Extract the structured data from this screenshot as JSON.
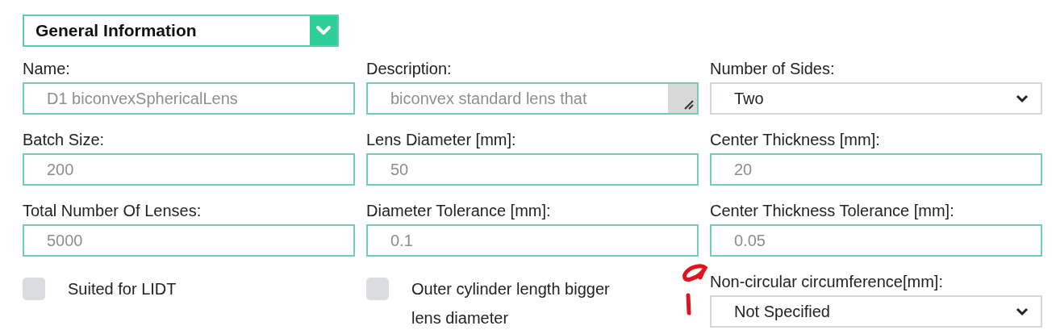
{
  "section": {
    "title": "General Information",
    "expanded": true
  },
  "fields": [
    {
      "kind": "text",
      "label": "Name:",
      "placeholder": "D1 biconvexSphericalLens"
    },
    {
      "kind": "textarea",
      "label": "Description:",
      "placeholder": "biconvex standard lens that"
    },
    {
      "kind": "select",
      "label": "Number of Sides:",
      "value": "Two"
    },
    {
      "kind": "text",
      "label": "Batch Size:",
      "placeholder": "200"
    },
    {
      "kind": "text",
      "label": "Lens Diameter [mm]:",
      "placeholder": "50"
    },
    {
      "kind": "text",
      "label": "Center Thickness [mm]:",
      "placeholder": "20"
    },
    {
      "kind": "text",
      "label": "Total Number Of Lenses:",
      "placeholder": "5000"
    },
    {
      "kind": "text",
      "label": "Diameter Tolerance [mm]:",
      "placeholder": "0.1"
    },
    {
      "kind": "text",
      "label": "Center Thickness Tolerance [mm]:",
      "placeholder": "0.05"
    },
    {
      "kind": "checkbox",
      "label": "Suited for LIDT",
      "checked": false
    },
    {
      "kind": "checkbox",
      "label": "Outer cylinder length bigger lens diameter",
      "checked": false
    },
    {
      "kind": "select",
      "label": "Non-circular circumference[mm]:",
      "value": "Not Specified",
      "annotated": true
    }
  ]
}
